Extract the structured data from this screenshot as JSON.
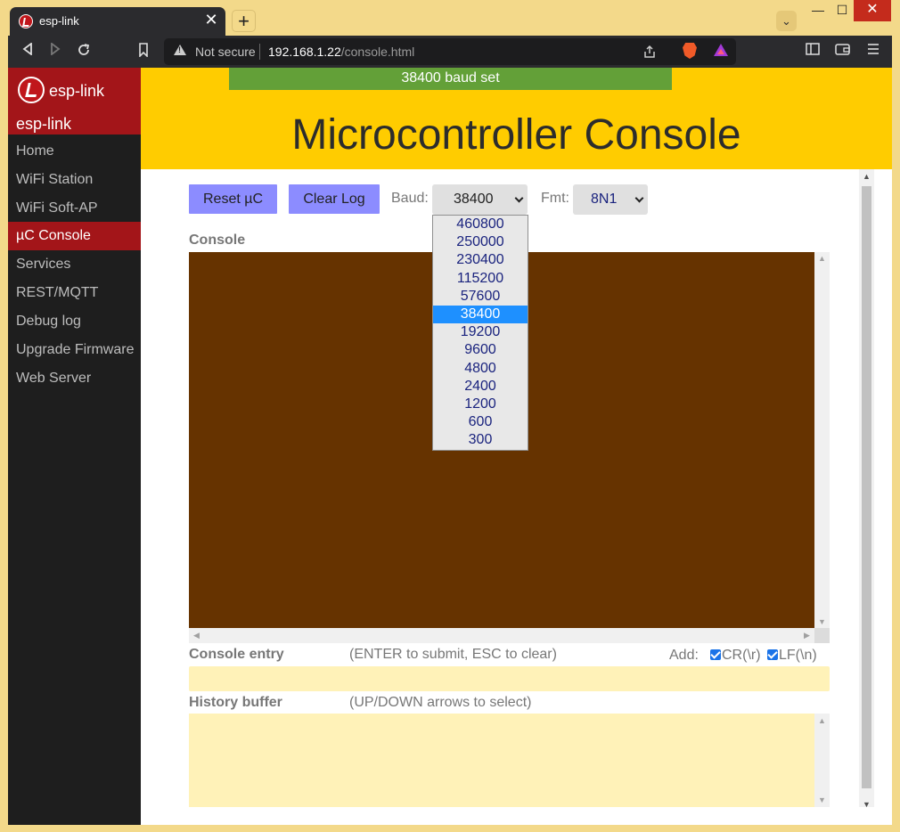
{
  "browser": {
    "tab_title": "esp-link",
    "tab_close": "✕",
    "new_tab": "+",
    "security_text": "Not secure",
    "url_host": "192.168.1.22",
    "url_path": "/console.html",
    "window_controls": {
      "minimize": "—",
      "maximize": "☐",
      "close": "✕"
    }
  },
  "sidebar": {
    "brand": "esp-link",
    "subtitle": "esp-link",
    "items": [
      {
        "label": "Home",
        "active": false
      },
      {
        "label": "WiFi Station",
        "active": false
      },
      {
        "label": "WiFi Soft-AP",
        "active": false
      },
      {
        "label": "µC Console",
        "active": true
      },
      {
        "label": "Services",
        "active": false
      },
      {
        "label": "REST/MQTT",
        "active": false
      },
      {
        "label": "Debug log",
        "active": false
      },
      {
        "label": "Upgrade Firmware",
        "active": false
      },
      {
        "label": "Web Server",
        "active": false
      }
    ]
  },
  "header": {
    "notice": "38400 baud set",
    "title": "Microcontroller Console"
  },
  "controls": {
    "reset_label": "Reset µC",
    "clear_label": "Clear Log",
    "baud_label": "Baud:",
    "baud_value": "38400",
    "fmt_label": "Fmt:",
    "fmt_value": "8N1"
  },
  "baud_options": [
    "460800",
    "250000",
    "230400",
    "115200",
    "57600",
    "38400",
    "19200",
    "9600",
    "4800",
    "2400",
    "1200",
    "600",
    "300"
  ],
  "console": {
    "label": "Console",
    "entry_label": "Console entry",
    "entry_hint": "(ENTER to submit, ESC to clear)",
    "add_label": "Add:",
    "cr_label": "CR(\\r)",
    "lf_label": "LF(\\n)",
    "history_label": "History buffer",
    "history_hint": "(UP/DOWN arrows to select)"
  },
  "colors": {
    "header_bg": "#ffcc00",
    "notice_bg": "#63a038",
    "sidebar_bg": "#1e1e1e",
    "accent_red": "#a31519",
    "button_bg": "#8c8cff",
    "console_bg": "#663300",
    "input_bg": "#fff2b8",
    "dropdown_selected": "#1e90ff"
  }
}
